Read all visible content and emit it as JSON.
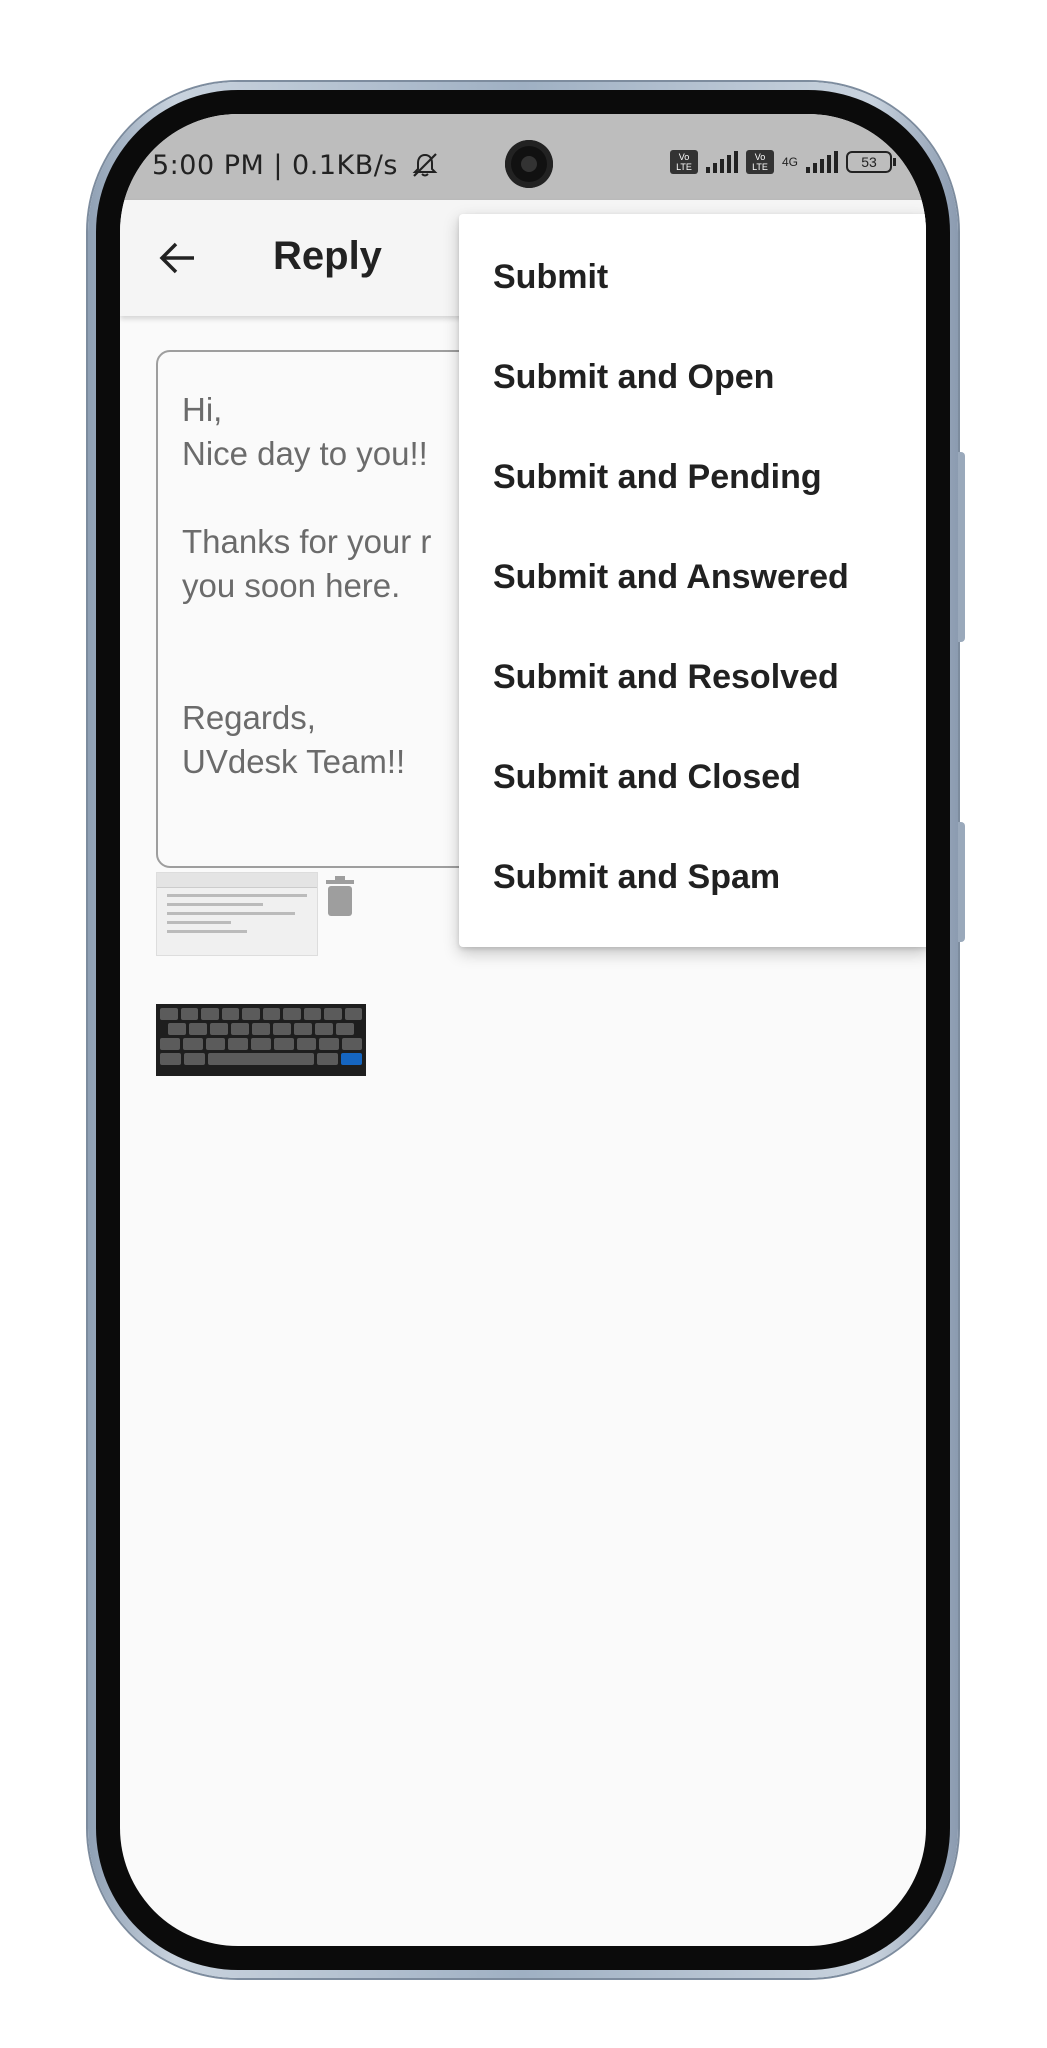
{
  "status_bar": {
    "left_text": "5:00 PM | 0.1KB/s",
    "network_type": "4G",
    "volte_label": "Vo LTE",
    "battery": "53"
  },
  "app_bar": {
    "title": "Reply"
  },
  "message": {
    "body": "Hi,\nNice day to you!!\n\nThanks for your r\nyou soon here.\n\n\nRegards,\nUVdesk Team!!"
  },
  "menu": {
    "items": [
      "Submit",
      "Submit and Open",
      "Submit and Pending",
      "Submit and Answered",
      "Submit and Resolved",
      "Submit and Closed",
      "Submit and Spam"
    ]
  },
  "icons": {
    "back": "arrow-left-icon",
    "delete": "trash-icon",
    "mute": "bell-off-icon"
  }
}
